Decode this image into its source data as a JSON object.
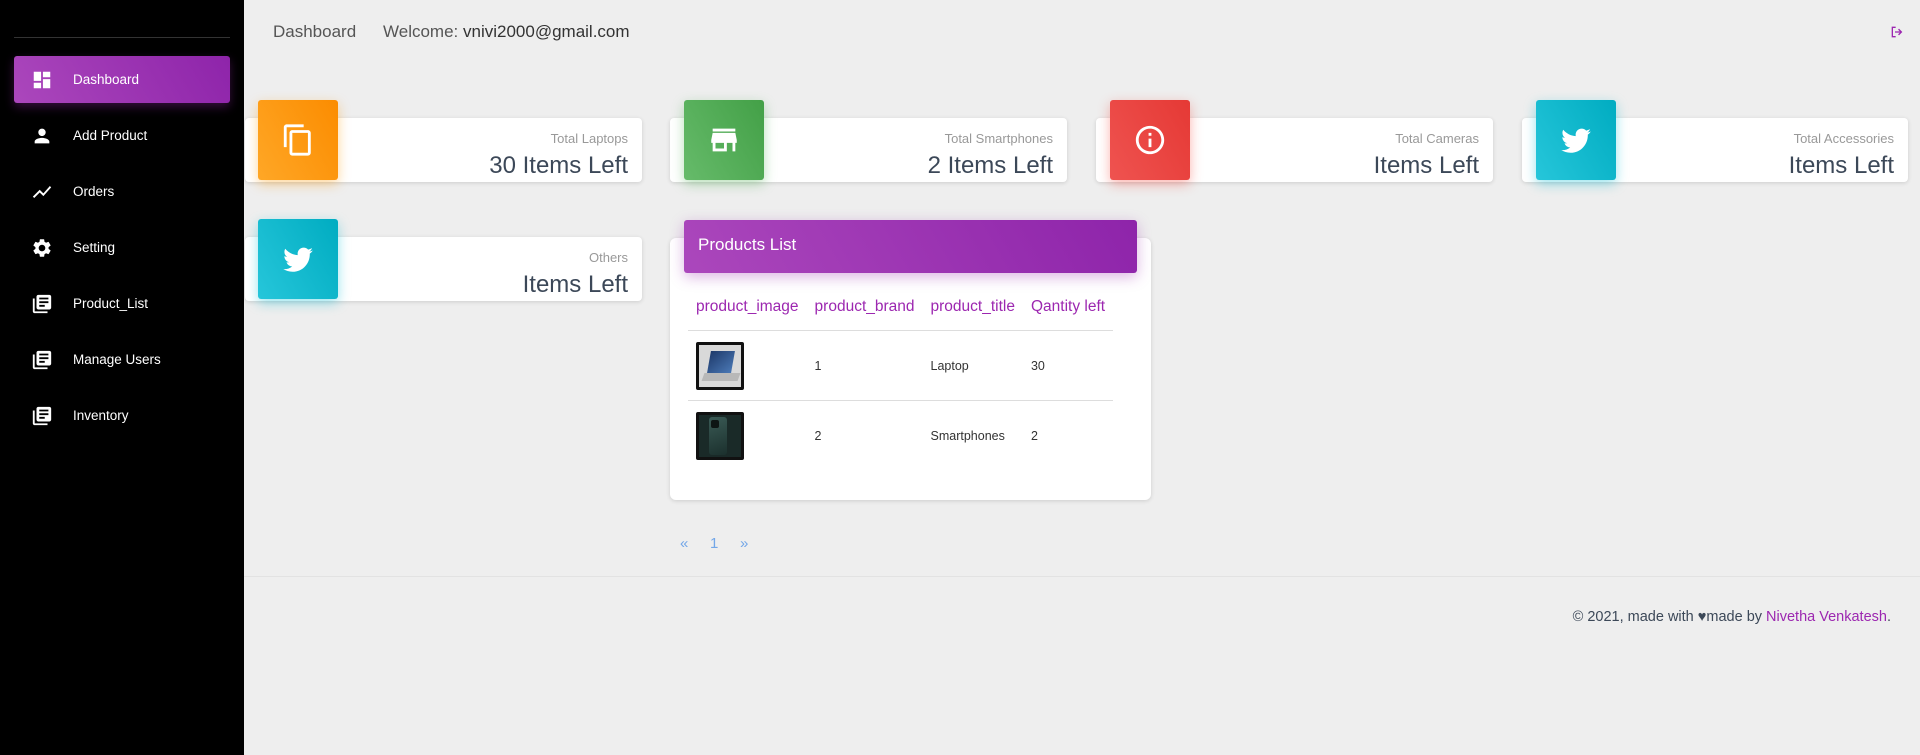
{
  "sidebar": {
    "items": [
      {
        "label": "Dashboard",
        "icon": "dashboard-icon",
        "active": true
      },
      {
        "label": "Add Product",
        "icon": "person-icon"
      },
      {
        "label": "Orders",
        "icon": "timeline-icon"
      },
      {
        "label": "Setting",
        "icon": "gear-icon"
      },
      {
        "label": "Product_List",
        "icon": "library-books-icon"
      },
      {
        "label": "Manage Users",
        "icon": "library-books-icon"
      },
      {
        "label": "Inventory",
        "icon": "library-books-icon"
      }
    ]
  },
  "topbar": {
    "brand": "Dashboard",
    "welcome_label": "Welcome:",
    "email": "vnivi2000@gmail.com",
    "logout_icon": "logout-icon"
  },
  "stats": [
    {
      "category": "Total Laptops",
      "value": "30 Items Left",
      "icon": "copy-icon",
      "color": "#fb8c00"
    },
    {
      "category": "Total Smartphones",
      "value": "2 Items Left",
      "icon": "store-icon",
      "color": "#43a047"
    },
    {
      "category": "Total Cameras",
      "value": "Items Left",
      "icon": "info-icon",
      "color": "#e53935"
    },
    {
      "category": "Total Accessories",
      "value": "Items Left",
      "icon": "twitter-icon",
      "color": "#00acc1"
    },
    {
      "category": "Others",
      "value": "Items Left",
      "icon": "twitter-icon",
      "color": "#00acc1"
    }
  ],
  "products": {
    "title": "Products List",
    "columns": [
      "product_image",
      "product_brand",
      "product_title",
      "Qantity left"
    ],
    "rows": [
      {
        "image": "laptop-thumbnail",
        "brand": "1",
        "title": "Laptop",
        "quantity": "30"
      },
      {
        "image": "smartphone-thumbnail",
        "brand": "2",
        "title": "Smartphones",
        "quantity": "2"
      }
    ]
  },
  "pagination": {
    "prev": "«",
    "page": "1",
    "next": "»"
  },
  "footer": {
    "prefix": "© 2021, made with",
    "heart": "♥",
    "made_by": "made by",
    "author": "Nivetha Venkatesh",
    "suffix": "."
  },
  "colors": {
    "accent": "#9c27b0",
    "sidebar_bg": "#000000",
    "page_bg": "#eeeeee"
  }
}
